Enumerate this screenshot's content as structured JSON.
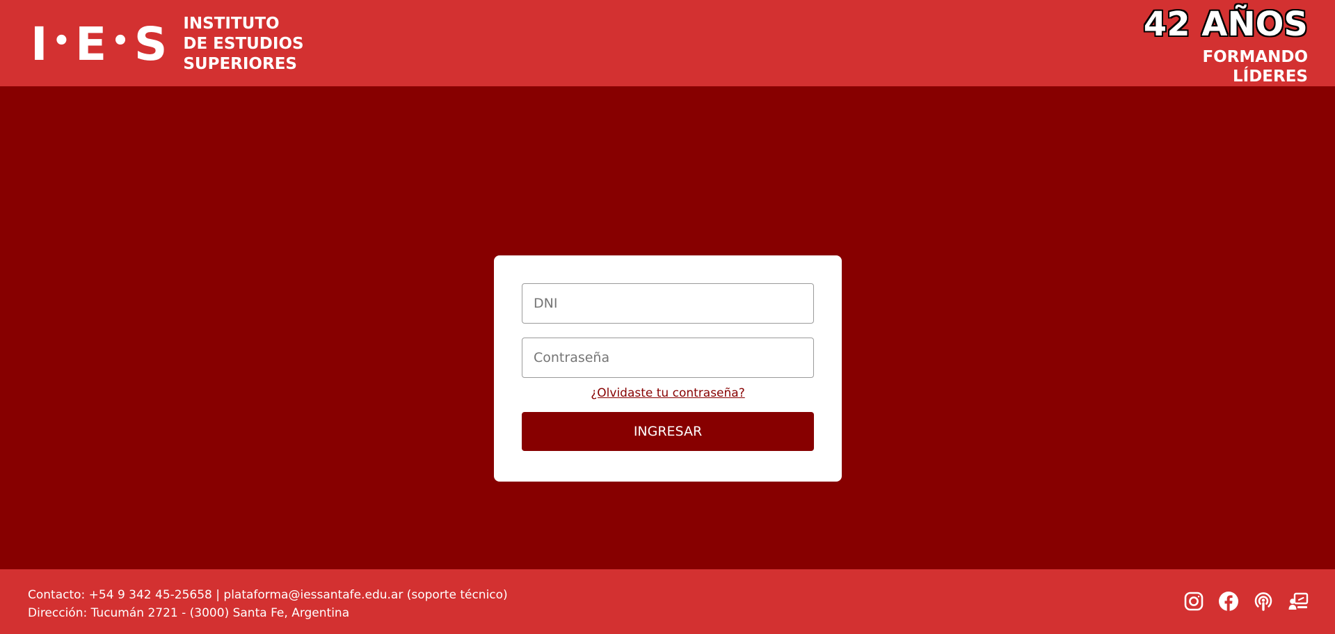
{
  "header": {
    "logo_mark": [
      "I",
      "E",
      "S"
    ],
    "logo_lines": [
      "INSTITUTO",
      "DE ESTUDIOS",
      "SUPERIORES"
    ],
    "tagline_years": "42 AÑOS",
    "tagline_lines": [
      "FORMANDO",
      "LÍDERES"
    ]
  },
  "login": {
    "user_placeholder": "DNI",
    "user_value": "",
    "password_placeholder": "Contraseña",
    "password_value": "",
    "forgot_label": "¿Olvidaste tu contraseña?",
    "submit_label": "INGRESAR"
  },
  "footer": {
    "contact_line": "Contacto: +54 9 342 45-25658 | plataforma@iessantafe.edu.ar (soporte técnico)",
    "address_line": "Dirección: Tucumán 2721 - (3000) Santa Fe, Argentina",
    "social_icons": [
      "instagram-icon",
      "facebook-icon",
      "podcast-icon",
      "presenter-icon"
    ]
  },
  "colors": {
    "background": "#870000",
    "header_footer": "#d33131",
    "card": "#ffffff",
    "accent": "#870000",
    "text_light": "#ffffff"
  }
}
